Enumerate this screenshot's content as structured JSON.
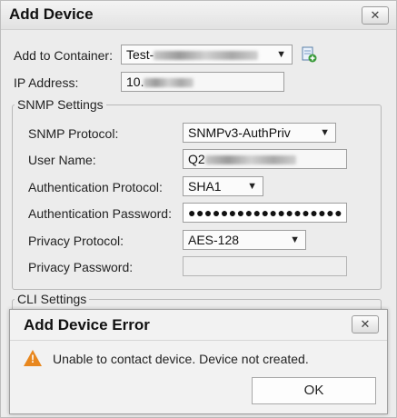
{
  "dialog": {
    "title": "Add Device",
    "close_label": "✕",
    "container_label": "Add to Container:",
    "container_value": "Test-",
    "ip_label": "IP Address:",
    "ip_value": "10.",
    "snmp_group": "SNMP Settings",
    "snmp_protocol_label": "SNMP Protocol:",
    "snmp_protocol_value": "SNMPv3-AuthPriv",
    "username_label": "User Name:",
    "username_value": "Q2",
    "auth_protocol_label": "Authentication Protocol:",
    "auth_protocol_value": "SHA1",
    "auth_password_label": "Authentication Password:",
    "auth_password_value": "●●●●●●●●●●●●●●●●●●●",
    "privacy_protocol_label": "Privacy Protocol:",
    "privacy_protocol_value": "AES-128",
    "privacy_password_label": "Privacy Password:",
    "privacy_password_value": "",
    "cli_group": "CLI Settings"
  },
  "error_dialog": {
    "title": "Add Device Error",
    "close_label": "✕",
    "message": "Unable to contact device. Device not created.",
    "ok_label": "OK"
  },
  "colors": {
    "warning_icon": "#e8871e",
    "dialog_bg": "#ececec"
  },
  "icons": [
    "close-icon",
    "add-container-icon",
    "warning-icon",
    "dropdown-caret-icon"
  ]
}
